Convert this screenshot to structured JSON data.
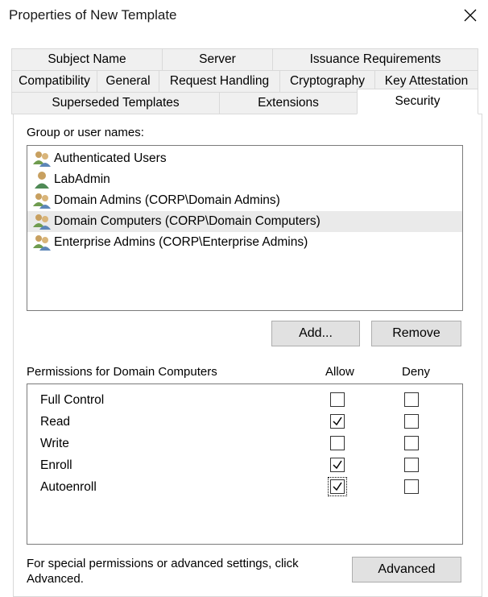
{
  "window": {
    "title": "Properties of New Template"
  },
  "tabs": {
    "row1": [
      {
        "label": "Subject Name"
      },
      {
        "label": "Server"
      },
      {
        "label": "Issuance Requirements"
      }
    ],
    "row2": [
      {
        "label": "Compatibility"
      },
      {
        "label": "General"
      },
      {
        "label": "Request Handling"
      },
      {
        "label": "Cryptography"
      },
      {
        "label": "Key Attestation"
      }
    ],
    "row3": [
      {
        "label": "Superseded Templates"
      },
      {
        "label": "Extensions"
      },
      {
        "label": "Security",
        "active": true
      }
    ]
  },
  "security": {
    "group_label": "Group or user names:",
    "users": [
      {
        "name": "Authenticated Users",
        "icon": "group-icon"
      },
      {
        "name": "LabAdmin",
        "icon": "user-icon"
      },
      {
        "name": "Domain Admins (CORP\\Domain Admins)",
        "icon": "group-icon"
      },
      {
        "name": "Domain Computers (CORP\\Domain Computers)",
        "icon": "group-icon",
        "selected": true
      },
      {
        "name": "Enterprise Admins (CORP\\Enterprise Admins)",
        "icon": "group-icon"
      }
    ],
    "add_label": "Add...",
    "remove_label": "Remove",
    "permissions_label": "Permissions for Domain Computers",
    "allow_label": "Allow",
    "deny_label": "Deny",
    "permissions": [
      {
        "name": "Full Control",
        "allow": false,
        "deny": false
      },
      {
        "name": "Read",
        "allow": true,
        "deny": false
      },
      {
        "name": "Write",
        "allow": false,
        "deny": false
      },
      {
        "name": "Enroll",
        "allow": true,
        "deny": false
      },
      {
        "name": "Autoenroll",
        "allow": true,
        "deny": false,
        "focused": true
      }
    ],
    "footer_text_1": "For special permissions or advanced settings, click",
    "footer_text_2": "Advanced.",
    "advanced_label": "Advanced"
  },
  "colors": {
    "selection": "#eaeaea",
    "button": "#e1e1e1",
    "tab": "#f0f0f0"
  }
}
